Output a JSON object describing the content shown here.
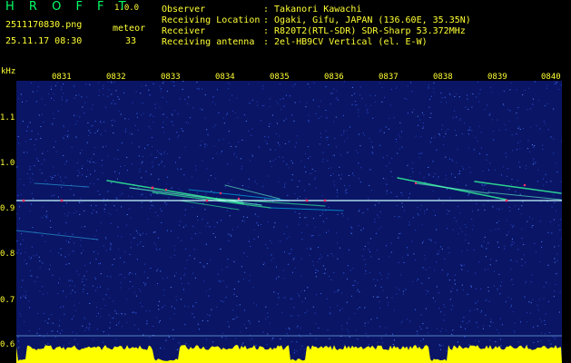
{
  "app": {
    "title": "H R O F F T",
    "version": "1.0.0"
  },
  "file": {
    "name": "2511170830.png",
    "datetime": "25.11.17 08:30"
  },
  "meteor": {
    "label": "meteor",
    "count": "33"
  },
  "info": [
    {
      "key": "Observer",
      "value": ": Takanori Kawachi"
    },
    {
      "key": "Receiving Location",
      "value": ": Ogaki, Gifu, JAPAN (136.60E, 35.35N)"
    },
    {
      "key": "Receiver",
      "value": ": R820T2(RTL-SDR) SDR-Sharp 53.372MHz"
    },
    {
      "key": "Receiving antenna",
      "value": ": 2el-HB9CV Vertical (el. E-W)"
    }
  ],
  "chart_data": {
    "type": "heatmap",
    "ylabel": "kHz",
    "y_ticks": [
      "1.1",
      "1.0",
      "0.9",
      "0.8",
      "0.7",
      "0.6"
    ],
    "x_ticks": [
      "0831",
      "0832",
      "0833",
      "0834",
      "0835",
      "0836",
      "0837",
      "0838",
      "0839",
      "0840"
    ],
    "ylim": [
      0.57,
      1.2
    ],
    "carrier_khz": 0.92,
    "colors": {
      "background": "#0a1566",
      "noise": "#2a4fd0",
      "echo": "#33ff99",
      "peak": "#ff3366",
      "baseband": "#ffff00"
    }
  }
}
